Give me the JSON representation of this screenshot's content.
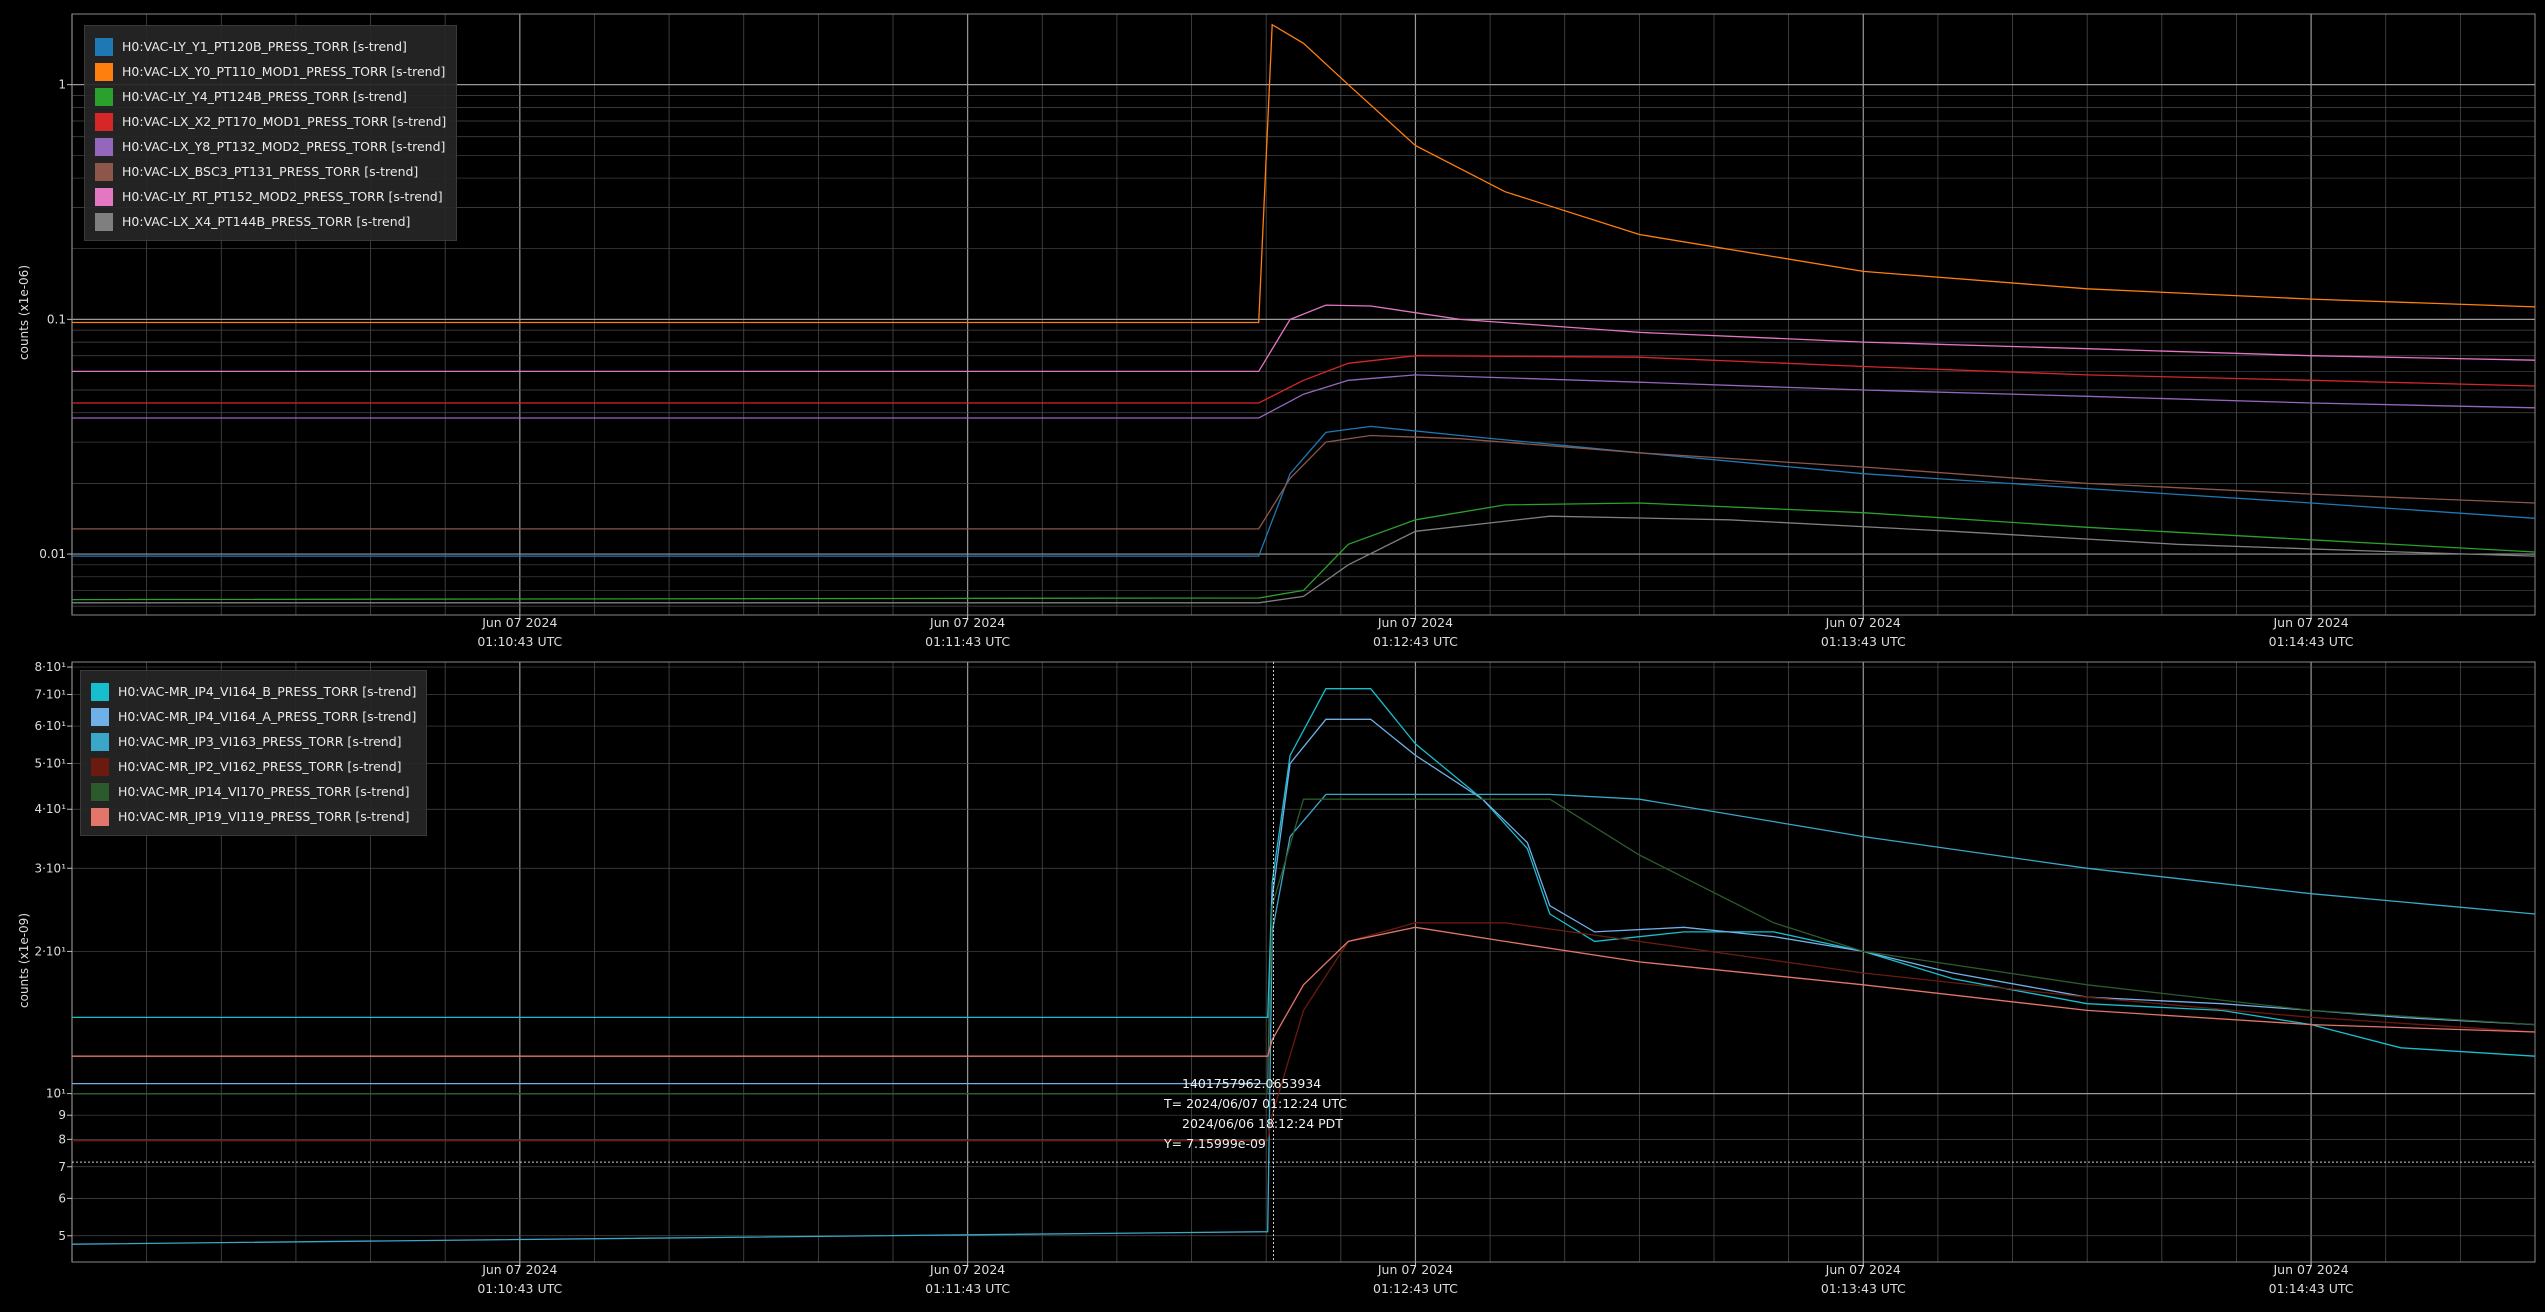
{
  "colors": {
    "background": "#000000",
    "grid": "#4a4a4a",
    "grid_major": "#9a9a9a",
    "axis_text": "#dcdcdc",
    "cursor": "#cfcfcf"
  },
  "chart_data": [
    {
      "type": "line",
      "ylabel": "counts (x1e-06)",
      "yscale": "log",
      "ylim": [
        0.0055,
        2.0
      ],
      "xlim": [
        -1.0,
        4.5
      ],
      "x_unit": "minutes since Jun 07 2024 01:10:43 UTC",
      "ytick_labels": [
        {
          "value": 0.01,
          "label": "0.01"
        },
        {
          "value": 0.1,
          "label": "0.1"
        },
        {
          "value": 1,
          "label": "1"
        }
      ],
      "xtick_labels": [
        {
          "value": 0,
          "date": "Jun 07 2024",
          "time": "01:10:43 UTC"
        },
        {
          "value": 1,
          "date": "Jun 07 2024",
          "time": "01:11:43 UTC"
        },
        {
          "value": 2,
          "date": "Jun 07 2024",
          "time": "01:12:43 UTC"
        },
        {
          "value": 3,
          "date": "Jun 07 2024",
          "time": "01:13:43 UTC"
        },
        {
          "value": 4,
          "date": "Jun 07 2024",
          "time": "01:14:43 UTC"
        }
      ],
      "legend_position": "top-left",
      "series": [
        {
          "name": "H0:VAC-LY_Y1_PT120B_PRESS_TORR [s-trend]",
          "color": "#1f77b4",
          "points": [
            [
              -1.0,
              0.0098
            ],
            [
              1.65,
              0.0098
            ],
            [
              1.72,
              0.022
            ],
            [
              1.8,
              0.033
            ],
            [
              1.9,
              0.035
            ],
            [
              2.1,
              0.032
            ],
            [
              2.5,
              0.027
            ],
            [
              3.0,
              0.022
            ],
            [
              3.5,
              0.019
            ],
            [
              4.0,
              0.0165
            ],
            [
              4.5,
              0.0142
            ]
          ]
        },
        {
          "name": "H0:VAC-LX_Y0_PT110_MOD1_PRESS_TORR [s-trend]",
          "color": "#ff7f0e",
          "points": [
            [
              -1.0,
              0.097
            ],
            [
              1.65,
              0.097
            ],
            [
              1.68,
              1.8
            ],
            [
              1.75,
              1.5
            ],
            [
              1.85,
              1.0
            ],
            [
              2.0,
              0.55
            ],
            [
              2.2,
              0.35
            ],
            [
              2.5,
              0.23
            ],
            [
              3.0,
              0.16
            ],
            [
              3.5,
              0.135
            ],
            [
              4.0,
              0.122
            ],
            [
              4.5,
              0.113
            ]
          ]
        },
        {
          "name": "H0:VAC-LY_Y4_PT124B_PRESS_TORR [s-trend]",
          "color": "#2ca02c",
          "points": [
            [
              -1.0,
              0.0064
            ],
            [
              1.65,
              0.0065
            ],
            [
              1.75,
              0.007
            ],
            [
              1.85,
              0.011
            ],
            [
              2.0,
              0.014
            ],
            [
              2.2,
              0.0162
            ],
            [
              2.5,
              0.0165
            ],
            [
              3.0,
              0.015
            ],
            [
              3.5,
              0.013
            ],
            [
              4.0,
              0.0115
            ],
            [
              4.5,
              0.0102
            ]
          ]
        },
        {
          "name": "H0:VAC-LX_X2_PT170_MOD1_PRESS_TORR [s-trend]",
          "color": "#d62728",
          "points": [
            [
              -1.0,
              0.044
            ],
            [
              1.65,
              0.044
            ],
            [
              1.75,
              0.055
            ],
            [
              1.85,
              0.065
            ],
            [
              2.0,
              0.07
            ],
            [
              2.5,
              0.069
            ],
            [
              3.0,
              0.063
            ],
            [
              3.5,
              0.058
            ],
            [
              4.0,
              0.055
            ],
            [
              4.5,
              0.052
            ]
          ]
        },
        {
          "name": "H0:VAC-LX_Y8_PT132_MOD2_PRESS_TORR [s-trend]",
          "color": "#9467bd",
          "points": [
            [
              -1.0,
              0.038
            ],
            [
              1.65,
              0.038
            ],
            [
              1.75,
              0.048
            ],
            [
              1.85,
              0.055
            ],
            [
              2.0,
              0.058
            ],
            [
              2.5,
              0.054
            ],
            [
              3.0,
              0.05
            ],
            [
              3.5,
              0.047
            ],
            [
              4.0,
              0.044
            ],
            [
              4.5,
              0.042
            ]
          ]
        },
        {
          "name": "H0:VAC-LX_BSC3_PT131_PRESS_TORR [s-trend]",
          "color": "#8c564b",
          "points": [
            [
              -1.0,
              0.0128
            ],
            [
              1.65,
              0.0128
            ],
            [
              1.72,
              0.021
            ],
            [
              1.8,
              0.03
            ],
            [
              1.9,
              0.032
            ],
            [
              2.1,
              0.031
            ],
            [
              2.5,
              0.027
            ],
            [
              3.0,
              0.0235
            ],
            [
              3.5,
              0.02
            ],
            [
              4.0,
              0.018
            ],
            [
              4.5,
              0.0165
            ]
          ]
        },
        {
          "name": "H0:VAC-LY_RT_PT152_MOD2_PRESS_TORR [s-trend]",
          "color": "#e377c2",
          "points": [
            [
              -1.0,
              0.06
            ],
            [
              1.65,
              0.06
            ],
            [
              1.72,
              0.1
            ],
            [
              1.8,
              0.115
            ],
            [
              1.9,
              0.114
            ],
            [
              2.1,
              0.1
            ],
            [
              2.5,
              0.088
            ],
            [
              3.0,
              0.08
            ],
            [
              3.5,
              0.075
            ],
            [
              4.0,
              0.07
            ],
            [
              4.5,
              0.067
            ]
          ]
        },
        {
          "name": "H0:VAC-LX_X4_PT144B_PRESS_TORR [s-trend]",
          "color": "#7f7f7f",
          "points": [
            [
              -1.0,
              0.0062
            ],
            [
              1.65,
              0.0062
            ],
            [
              1.75,
              0.0066
            ],
            [
              1.85,
              0.009
            ],
            [
              2.0,
              0.0125
            ],
            [
              2.3,
              0.0145
            ],
            [
              2.7,
              0.014
            ],
            [
              3.2,
              0.0125
            ],
            [
              3.7,
              0.011
            ],
            [
              4.2,
              0.0102
            ],
            [
              4.5,
              0.0098
            ]
          ]
        }
      ]
    },
    {
      "type": "line",
      "ylabel": "counts (x1e-09)",
      "yscale": "log",
      "ylim": [
        4.4,
        82
      ],
      "xlim": [
        -1.0,
        4.5
      ],
      "x_unit": "minutes since Jun 07 2024 01:10:43 UTC",
      "ytick_labels": [
        {
          "value": 5,
          "label": "5"
        },
        {
          "value": 6,
          "label": "6"
        },
        {
          "value": 7,
          "label": "7"
        },
        {
          "value": 8,
          "label": "8"
        },
        {
          "value": 9,
          "label": "9"
        },
        {
          "value": 10,
          "label": "10¹"
        },
        {
          "value": 20,
          "label": "2·10¹"
        },
        {
          "value": 30,
          "label": "3·10¹"
        },
        {
          "value": 40,
          "label": "4·10¹"
        },
        {
          "value": 50,
          "label": "5·10¹"
        },
        {
          "value": 60,
          "label": "6·10¹"
        },
        {
          "value": 70,
          "label": "7·10¹"
        },
        {
          "value": 80,
          "label": "8·10¹"
        }
      ],
      "xtick_labels": [
        {
          "value": 0,
          "date": "Jun 07 2024",
          "time": "01:10:43 UTC"
        },
        {
          "value": 1,
          "date": "Jun 07 2024",
          "time": "01:11:43 UTC"
        },
        {
          "value": 2,
          "date": "Jun 07 2024",
          "time": "01:12:43 UTC"
        },
        {
          "value": 3,
          "date": "Jun 07 2024",
          "time": "01:13:43 UTC"
        },
        {
          "value": 4,
          "date": "Jun 07 2024",
          "time": "01:14:43 UTC"
        }
      ],
      "legend_position": "top-left",
      "cursor": {
        "x": 1.683,
        "y": 7.16,
        "lines": [
          "1401757962.0653934",
          "T= 2024/06/07 01:12:24 UTC",
          "2024/06/06 18:12:24 PDT",
          "Y= 7.15999e-09"
        ]
      },
      "series": [
        {
          "name": "H0:VAC-MR_IP4_VI164_B_PRESS_TORR [s-trend]",
          "color": "#17becf",
          "points": [
            [
              -1.0,
              14.5
            ],
            [
              1.67,
              14.5
            ],
            [
              1.68,
              28
            ],
            [
              1.72,
              52
            ],
            [
              1.8,
              72
            ],
            [
              1.9,
              72
            ],
            [
              2.0,
              55
            ],
            [
              2.15,
              42
            ],
            [
              2.25,
              33
            ],
            [
              2.3,
              24
            ],
            [
              2.4,
              21
            ],
            [
              2.6,
              22
            ],
            [
              2.8,
              22
            ],
            [
              3.0,
              20
            ],
            [
              3.2,
              17.5
            ],
            [
              3.5,
              15.5
            ],
            [
              3.8,
              15
            ],
            [
              4.0,
              14
            ],
            [
              4.2,
              12.5
            ],
            [
              4.5,
              12
            ]
          ]
        },
        {
          "name": "H0:VAC-MR_IP4_VI164_A_PRESS_TORR [s-trend]",
          "color": "#6fb0e8",
          "points": [
            [
              -1.0,
              10.5
            ],
            [
              1.67,
              10.5
            ],
            [
              1.68,
              26
            ],
            [
              1.72,
              50
            ],
            [
              1.8,
              62
            ],
            [
              1.9,
              62
            ],
            [
              2.0,
              52
            ],
            [
              2.15,
              42
            ],
            [
              2.25,
              34
            ],
            [
              2.3,
              25
            ],
            [
              2.4,
              22
            ],
            [
              2.6,
              22.5
            ],
            [
              2.8,
              21.5
            ],
            [
              3.0,
              20
            ],
            [
              3.2,
              18
            ],
            [
              3.5,
              16
            ],
            [
              3.8,
              15.5
            ],
            [
              4.0,
              15
            ],
            [
              4.2,
              14.5
            ],
            [
              4.5,
              14
            ]
          ]
        },
        {
          "name": "H0:VAC-MR_IP3_VI163_PRESS_TORR [s-trend]",
          "color": "#3aa7c9",
          "points": [
            [
              -1.0,
              4.8
            ],
            [
              1.67,
              5.1
            ],
            [
              1.68,
              22
            ],
            [
              1.72,
              35
            ],
            [
              1.8,
              43
            ],
            [
              2.0,
              43
            ],
            [
              2.3,
              43
            ],
            [
              2.5,
              42
            ],
            [
              3.0,
              35
            ],
            [
              3.5,
              30
            ],
            [
              4.0,
              26.5
            ],
            [
              4.5,
              24
            ]
          ]
        },
        {
          "name": "H0:VAC-MR_IP2_VI162_PRESS_TORR [s-trend]",
          "color": "#6b1a10",
          "points": [
            [
              -1.0,
              7.95
            ],
            [
              1.67,
              7.95
            ],
            [
              1.68,
              9
            ],
            [
              1.75,
              15
            ],
            [
              1.85,
              21
            ],
            [
              2.0,
              23
            ],
            [
              2.2,
              23
            ],
            [
              2.5,
              21
            ],
            [
              3.0,
              18
            ],
            [
              3.5,
              16
            ],
            [
              4.0,
              14.5
            ],
            [
              4.5,
              13.5
            ]
          ]
        },
        {
          "name": "H0:VAC-MR_IP14_VI170_PRESS_TORR [s-trend]",
          "color": "#2d5a2d",
          "points": [
            [
              -1.0,
              10.0
            ],
            [
              1.67,
              10.0
            ],
            [
              1.68,
              25
            ],
            [
              1.75,
              42
            ],
            [
              2.3,
              42
            ],
            [
              2.5,
              32
            ],
            [
              2.8,
              23
            ],
            [
              3.0,
              20
            ],
            [
              3.5,
              17
            ],
            [
              4.0,
              15
            ],
            [
              4.5,
              14
            ]
          ]
        },
        {
          "name": "H0:VAC-MR_IP19_VI119_PRESS_TORR [s-trend]",
          "color": "#e2766b",
          "points": [
            [
              -1.0,
              12.0
            ],
            [
              1.67,
              12.0
            ],
            [
              1.68,
              13
            ],
            [
              1.75,
              17
            ],
            [
              1.85,
              21
            ],
            [
              2.0,
              22.5
            ],
            [
              2.2,
              21
            ],
            [
              2.5,
              19
            ],
            [
              3.0,
              17
            ],
            [
              3.5,
              15
            ],
            [
              4.0,
              14
            ],
            [
              4.5,
              13.5
            ]
          ]
        }
      ]
    }
  ]
}
